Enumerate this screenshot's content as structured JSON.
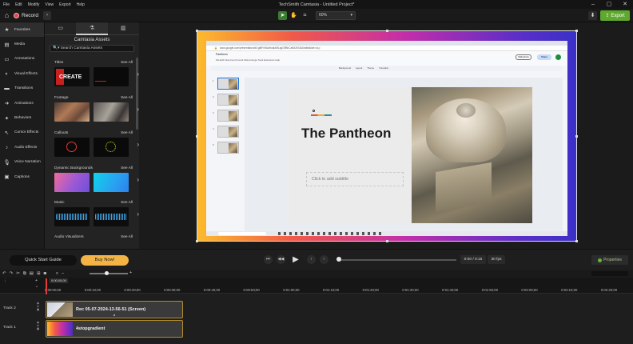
{
  "window": {
    "menus": [
      "File",
      "Edit",
      "Modify",
      "View",
      "Export",
      "Help"
    ],
    "title": "TechSmith Camtasia - Untitled Project*",
    "controls": [
      "–",
      "▢",
      "✕"
    ]
  },
  "toolbar": {
    "record_label": "Record",
    "zoom_value": "60%",
    "export_label": "Export"
  },
  "nav": {
    "items": [
      {
        "label": "Favorites",
        "icon": "star-icon"
      },
      {
        "label": "Media",
        "icon": "media-icon"
      },
      {
        "label": "Annotations",
        "icon": "annotation-icon"
      },
      {
        "label": "Visual Effects",
        "icon": "visual-effects-icon"
      },
      {
        "label": "Transitions",
        "icon": "transitions-icon"
      },
      {
        "label": "Animations",
        "icon": "animations-icon"
      },
      {
        "label": "Behaviors",
        "icon": "behaviors-icon"
      },
      {
        "label": "Cursor Effects",
        "icon": "cursor-icon"
      },
      {
        "label": "Audio Effects",
        "icon": "audio-icon"
      },
      {
        "label": "Voice Narration",
        "icon": "microphone-icon"
      },
      {
        "label": "Captions",
        "icon": "captions-icon"
      }
    ]
  },
  "assets": {
    "title": "Camtasia Assets",
    "search_placeholder": "Search Camtasia Assets",
    "see_all": "See All",
    "sections": [
      "Titles",
      "Footage",
      "Callouts",
      "Dynamic Backgrounds",
      "Music",
      "Audio Visualizers"
    ],
    "title_thumb_text": "CREATE"
  },
  "browser": {
    "url": "docs.google.com/presentation/d/1g6tFn9AaHodiaSfLkgO9BhCa9AXIS4lA/edit#slide=id.p",
    "doc_title": "Pantheon",
    "menus": "File  Edit  View  Insert  Format  Slide  Arrange  Tools  Extensions  Help",
    "format_items": [
      "Background",
      "Layout",
      "Theme",
      "Transition"
    ],
    "slideshow": "Slideshow",
    "share": "Share",
    "notes": "Click to add speaker notes"
  },
  "slide": {
    "heading": "The Pantheon",
    "subtitle_placeholder": "Click to add subtitle"
  },
  "playback": {
    "quick_start": "Quick Start Guide",
    "buy_now": "Buy Now!",
    "time": "0:00 / 0:15",
    "fps": "30 fps",
    "properties": "Properties"
  },
  "timeline": {
    "playhead_time": "0:00:00;00",
    "ticks": [
      "0:00:00;00",
      "0:00:10;00",
      "0:00:20;00",
      "0:00:30;00",
      "0:00:40;00",
      "0:00:50;00",
      "0:01:00;00",
      "0:01:10;00",
      "0:01:20;00",
      "0:01:30;00",
      "0:01:40;00",
      "0:01:50;00",
      "0:02:00;00",
      "0:02:10;00",
      "0:02:20;00"
    ],
    "tracks": [
      {
        "name": "Track 2",
        "clip": "Rec 05-07-2024-13-56-51 (Screen)"
      },
      {
        "name": "Track 1",
        "clip": "4stopgradient"
      }
    ]
  },
  "colors": {
    "accent_green": "#5fa82e",
    "buy_orange": "#f3b445",
    "record_red": "#e84545",
    "clip_border": "#b58b2c"
  }
}
